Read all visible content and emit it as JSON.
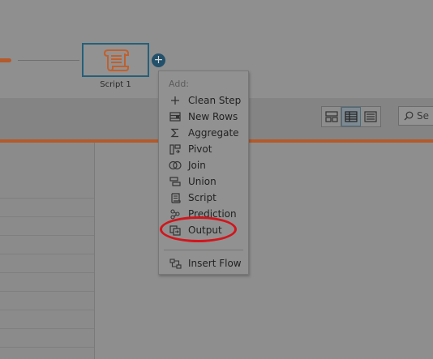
{
  "flow": {
    "node_label": "Script 1",
    "node_icon": "script-scroll-icon",
    "add_button_icon": "plus-icon"
  },
  "menu": {
    "header": "Add:",
    "items": [
      {
        "label": "Clean Step",
        "icon": "plus-icon"
      },
      {
        "label": "New Rows",
        "icon": "new-rows-icon"
      },
      {
        "label": "Aggregate",
        "icon": "sigma-icon"
      },
      {
        "label": "Pivot",
        "icon": "pivot-icon"
      },
      {
        "label": "Join",
        "icon": "join-icon"
      },
      {
        "label": "Union",
        "icon": "union-icon"
      },
      {
        "label": "Script",
        "icon": "script-icon"
      },
      {
        "label": "Prediction",
        "icon": "prediction-icon"
      },
      {
        "label": "Output",
        "icon": "output-icon"
      },
      {
        "label": "Insert Flow",
        "icon": "insert-flow-icon"
      }
    ]
  },
  "toolbar": {
    "search_text": "Se",
    "view_buttons": [
      "card-view-icon",
      "table-view-icon",
      "list-view-icon"
    ]
  },
  "colors": {
    "accent_orange": "#b45a2b",
    "node_border": "#24607a",
    "highlight": "#d2151c"
  }
}
